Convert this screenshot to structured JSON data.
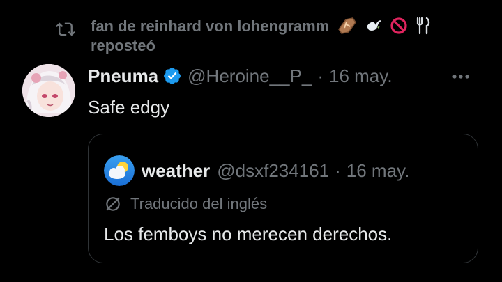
{
  "repost": {
    "icon": "repost-icon",
    "user": "fan de reinhard von lohengramm",
    "emojis": [
      "coffin-emoji",
      "dove-emoji",
      "prohibited-emoji",
      "fork-knife-emoji"
    ],
    "action": "reposteó"
  },
  "tweet": {
    "avatar": "anime-avatar",
    "name": "Pneuma",
    "verified_icon": "verified-badge-icon",
    "handle": "@Heroine__P_",
    "separator": "·",
    "date": "16 may.",
    "more_icon": "more-icon",
    "text": "Safe edgy"
  },
  "quote": {
    "avatar": "weather-avatar",
    "name": "weather",
    "handle": "@dsxf234161",
    "separator": "·",
    "date": "16 may.",
    "translation_icon": "globe-icon",
    "translation_label": "Traducido del inglés",
    "text": "Los femboys no merecen derechos."
  },
  "colors": {
    "background": "#000000",
    "primary_text": "#e7e9ea",
    "secondary_text": "#71767b",
    "border": "#2f3336",
    "verified": "#1d9bf0"
  }
}
